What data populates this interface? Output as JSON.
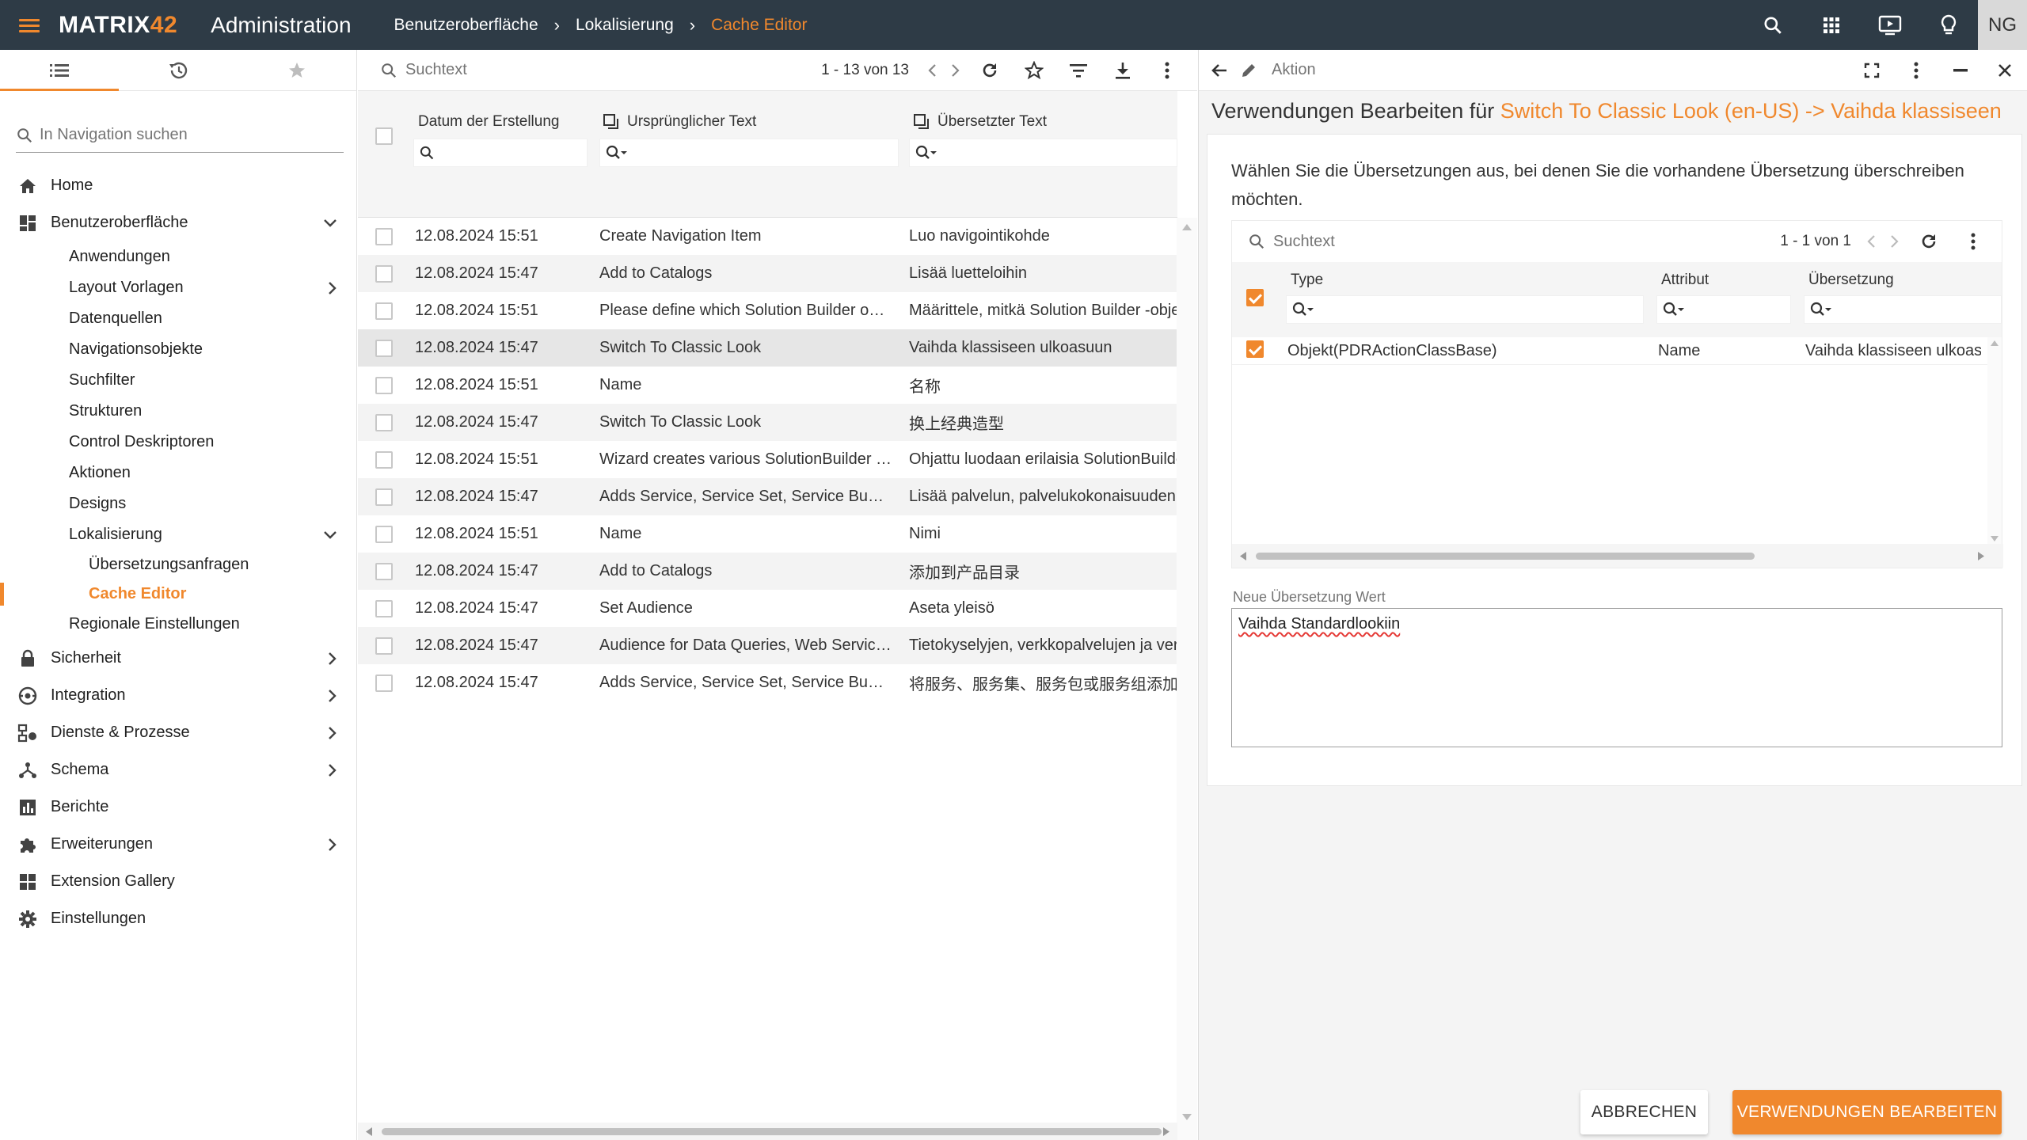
{
  "colors": {
    "accent": "#f0882d",
    "topbar": "#2e3b46",
    "text": "#212121"
  },
  "header": {
    "logo_main": "MATRIX",
    "logo_num": "42",
    "title": "Administration",
    "breadcrumb": [
      "Benutzeroberfläche",
      "Lokalisierung",
      "Cache Editor"
    ],
    "avatar": "NG",
    "icons": [
      "search-icon",
      "apps-grid-icon",
      "presentation-icon",
      "lightbulb-icon"
    ]
  },
  "nav": {
    "search_placeholder": "In Navigation suchen",
    "items": [
      {
        "label": "Home",
        "icon": "home-icon"
      },
      {
        "label": "Benutzeroberfläche",
        "icon": "dashboard-icon",
        "expanded": true
      },
      {
        "label": "Sicherheit",
        "icon": "lock-icon"
      },
      {
        "label": "Integration",
        "icon": "integration-icon"
      },
      {
        "label": "Dienste & Prozesse",
        "icon": "process-icon"
      },
      {
        "label": "Schema",
        "icon": "schema-icon"
      },
      {
        "label": "Berichte",
        "icon": "chart-icon"
      },
      {
        "label": "Erweiterungen",
        "icon": "puzzle-icon"
      },
      {
        "label": "Extension Gallery",
        "icon": "gallery-icon"
      },
      {
        "label": "Einstellungen",
        "icon": "gear-icon"
      }
    ],
    "ui_children": [
      "Anwendungen",
      "Layout Vorlagen",
      "Datenquellen",
      "Navigationsobjekte",
      "Suchfilter",
      "Strukturen",
      "Control Deskriptoren",
      "Aktionen",
      "Designs",
      "Lokalisierung"
    ],
    "localization_children": [
      "Übersetzungsanfragen",
      "Cache Editor"
    ],
    "regional": "Regionale Einstellungen"
  },
  "grid": {
    "search_placeholder": "Suchtext",
    "pager": "1 - 13 von 13",
    "columns": [
      "Datum der Erstellung",
      "Ursprünglicher Text",
      "Übersetzter Text"
    ],
    "rows": [
      [
        "12.08.2024 15:51",
        "Create Navigation Item",
        "Luo navigointikohde"
      ],
      [
        "12.08.2024 15:47",
        "Add to Catalogs",
        "Lisää luetteloihin"
      ],
      [
        "12.08.2024 15:51",
        "Please define which Solution Builder obj…",
        "Määrittele, mitkä Solution Builder -obje"
      ],
      [
        "12.08.2024 15:47",
        "Switch To Classic Look",
        "Vaihda klassiseen ulkoasuun"
      ],
      [
        "12.08.2024 15:51",
        "Name",
        "名称"
      ],
      [
        "12.08.2024 15:47",
        "Switch To Classic Look",
        "换上经典造型"
      ],
      [
        "12.08.2024 15:51",
        "Wizard creates various SolutionBuilder …",
        "Ohjattu luodaan erilaisia SolutionBuilde"
      ],
      [
        "12.08.2024 15:47",
        "Adds Service, Service Set, Service Bundl…",
        "Lisää palvelun, palvelukokonaisuuden"
      ],
      [
        "12.08.2024 15:51",
        "Name",
        "Nimi"
      ],
      [
        "12.08.2024 15:47",
        "Add to Catalogs",
        "添加到产品目录"
      ],
      [
        "12.08.2024 15:47",
        "Set Audience",
        "Aseta yleisö"
      ],
      [
        "12.08.2024 15:47",
        "Audience for Data Queries, Web Service…",
        "Tietokyselyjen, verkkopalvelujen ja ver"
      ],
      [
        "12.08.2024 15:47",
        "Adds Service, Service Set, Service Bundl…",
        "将服务、服务集、服务包或服务组添加"
      ]
    ]
  },
  "panel": {
    "title": "Aktion",
    "heading_prefix": "Verwendungen Bearbeiten für ",
    "heading_highlight": "Switch To Classic Look (en-US) -> Vaihda klassiseen",
    "description": "Wählen Sie die Übersetzungen aus, bei denen Sie die vorhandene Übersetzung überschreiben möchten.",
    "search_placeholder": "Suchtext",
    "pager": "1 - 1 von 1",
    "columns": [
      "Type",
      "Attribut",
      "Übersetzung"
    ],
    "rows": [
      [
        "Objekt(PDRActionClassBase)",
        "Name",
        "Vaihda klassiseen ulkoas"
      ]
    ],
    "field_label": "Neue Übersetzung Wert",
    "field_value": "Vaihda Standardlookiin",
    "cancel_label": "ABBRECHEN",
    "submit_label": "VERWENDUNGEN BEARBEITEN"
  }
}
